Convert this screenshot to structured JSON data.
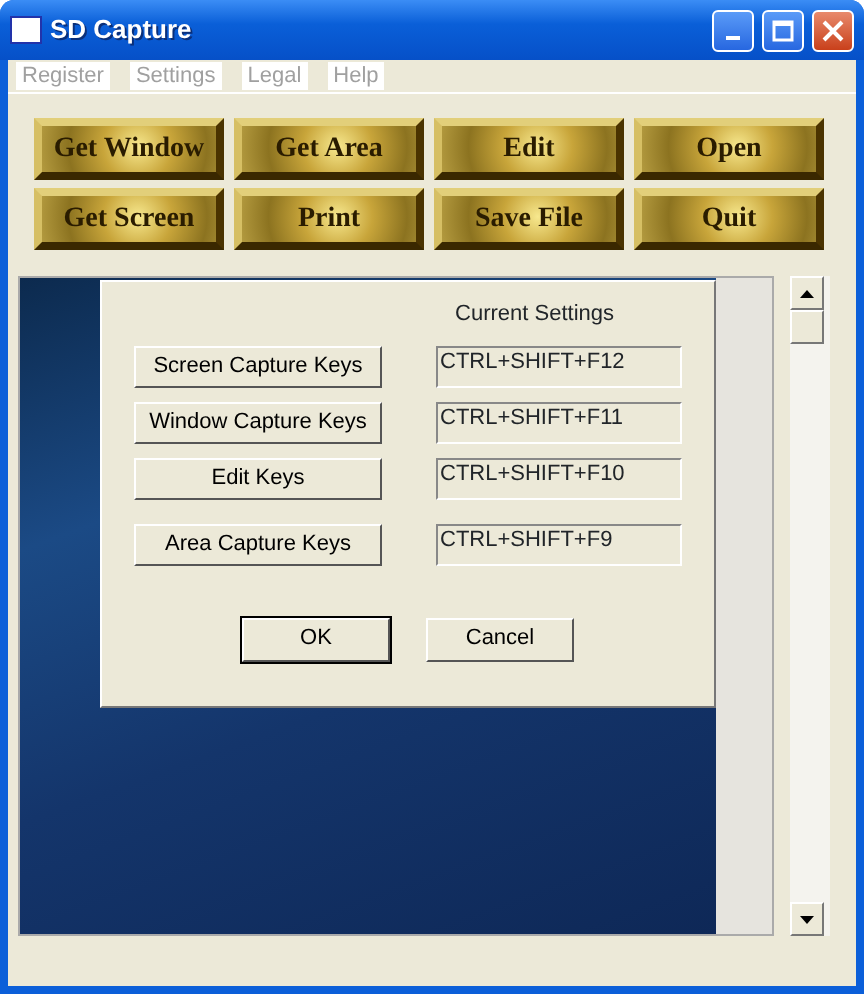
{
  "window": {
    "title": "SD Capture"
  },
  "menu": [
    {
      "label": "Register",
      "disabled": true
    },
    {
      "label": "Settings",
      "disabled": true
    },
    {
      "label": "Legal",
      "disabled": true
    },
    {
      "label": "Help",
      "disabled": true
    }
  ],
  "toolbar_buttons": [
    "Get Window",
    "Get Area",
    "Edit",
    "Open",
    "Get Screen",
    "Print",
    "Save File",
    "Quit"
  ],
  "dialog": {
    "heading": "Current Settings",
    "rows": [
      {
        "button": "Screen Capture Keys",
        "value": "CTRL+SHIFT+F12"
      },
      {
        "button": "Window Capture Keys",
        "value": "CTRL+SHIFT+F11"
      },
      {
        "button": "Edit Keys",
        "value": "CTRL+SHIFT+F10"
      },
      {
        "button": "Area Capture Keys",
        "value": "CTRL+SHIFT+F9"
      }
    ],
    "buttons": [
      {
        "label": "OK",
        "default": true
      },
      {
        "label": "Cancel",
        "default": false
      }
    ]
  }
}
